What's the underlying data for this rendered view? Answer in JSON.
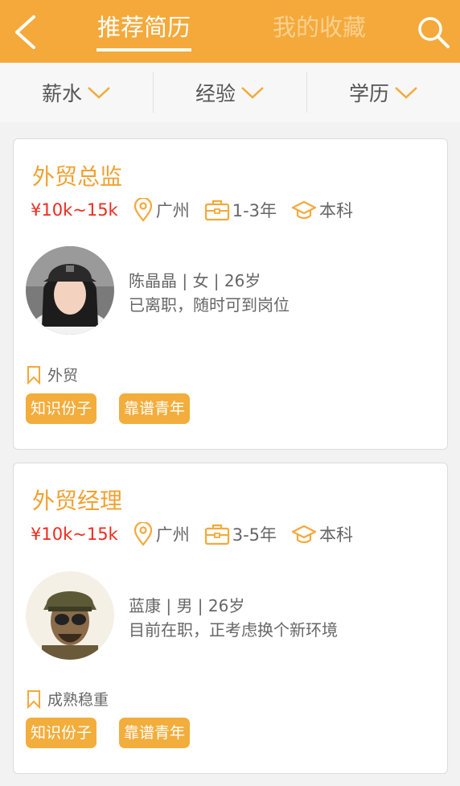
{
  "header": {
    "tab_active": "推荐简历",
    "tab_inactive": "我的收藏"
  },
  "filters": [
    "薪水",
    "经验",
    "学历"
  ],
  "colors": {
    "brand": "#f4a93a",
    "title": "#f0a132",
    "salary": "#ef2a1d",
    "chip": "#f3ad3c"
  },
  "resumes": [
    {
      "title": "外贸总监",
      "salary": "¥10k~15k",
      "city": "广州",
      "experience": "1-3年",
      "education": "本科",
      "profile": "陈晶晶 | 女 | 26岁",
      "status": "已离职，随时可到岗位",
      "industry": "外贸",
      "chips": [
        "知识份子",
        "靠谱青年"
      ]
    },
    {
      "title": "外贸经理",
      "salary": "¥10k~15k",
      "city": "广州",
      "experience": "3-5年",
      "education": "本科",
      "profile": "蓝康 | 男 | 26岁",
      "status": "目前在职，正考虑换个新环境",
      "industry": "成熟稳重",
      "chips": [
        "知识份子",
        "靠谱青年"
      ]
    }
  ]
}
